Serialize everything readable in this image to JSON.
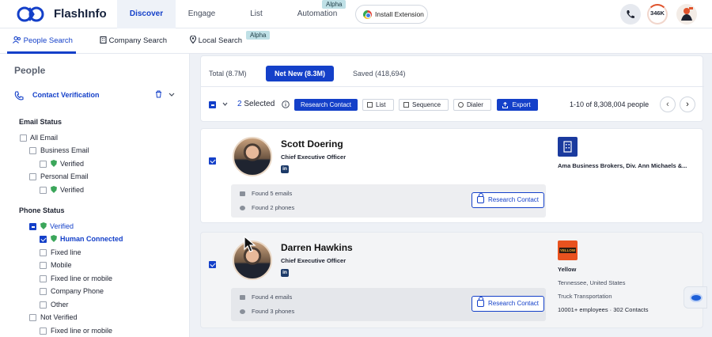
{
  "app": {
    "name": "FlashInfo"
  },
  "nav": {
    "tabs": [
      {
        "label": "Discover"
      },
      {
        "label": "Engage"
      },
      {
        "label": "List"
      },
      {
        "label": "Automation",
        "badge": "Alpha"
      }
    ],
    "install_extension": "Install Extension",
    "credits": "346K"
  },
  "subnav": {
    "people_search": "People Search",
    "company_search": "Company Search",
    "local_search": "Local Search",
    "local_badge": "Alpha"
  },
  "sidebar": {
    "title": "People",
    "section": "Contact Verification",
    "email_status": {
      "label": "Email Status",
      "all_email": "All Email",
      "business_email": "Business Email",
      "business_verified": "Verified",
      "personal_email": "Personal Email",
      "personal_verified": "Verified"
    },
    "phone_status": {
      "label": "Phone Status",
      "verified": "Verified",
      "human_connected": "Human Connected",
      "fixed_line": "Fixed line",
      "mobile": "Mobile",
      "fixed_or_mobile": "Fixed line or mobile",
      "company_phone": "Company Phone",
      "other": "Other",
      "not_verified": "Not Verified",
      "nv_fixed_or_mobile": "Fixed line or mobile"
    }
  },
  "results": {
    "tabs": {
      "total": "Total (8.7M)",
      "net_new": "Net New (8.3M)",
      "saved": "Saved (418,694)"
    },
    "selected_count": "2",
    "selected_label": "Selected",
    "toolbar": {
      "research": "Research Contact",
      "list": "List",
      "sequence": "Sequence",
      "dialer": "Dialer",
      "export": "Export"
    },
    "pagination": "1-10 of 8,308,004 people"
  },
  "contacts": [
    {
      "name": "Scott Doering",
      "title": "Chief Executive Officer",
      "found_emails": "Found 5 emails",
      "found_phones": "Found 2 phones",
      "research": "Research Contact",
      "company": "Ama Business Brokers, Div. Ann Michaels &..."
    },
    {
      "name": "Darren Hawkins",
      "title": "Chief Executive Officer",
      "found_emails": "Found 4 emails",
      "found_phones": "Found 3 phones",
      "research": "Research Contact",
      "company": "Yellow",
      "location": "Tennessee, United States",
      "industry": "Truck Transportation",
      "size": "10001+ employees · 302 Contacts",
      "logo_text": "YELLOW"
    }
  ],
  "colors": {
    "accent": "#1440c9",
    "verified": "#3ba65a"
  }
}
